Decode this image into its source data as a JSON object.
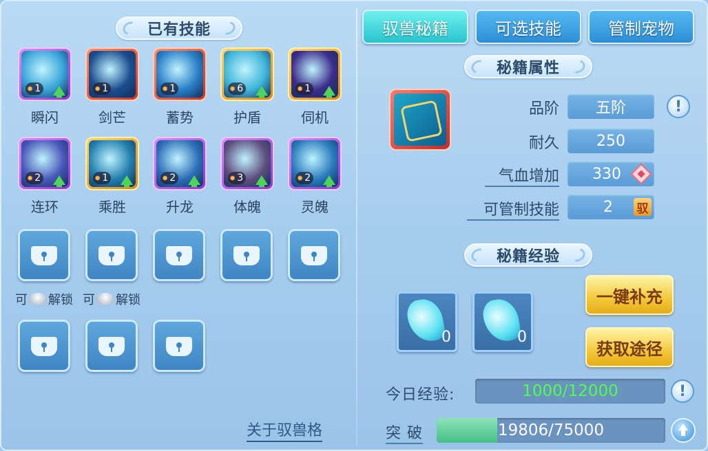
{
  "left": {
    "title": "已有技能",
    "skills": [
      {
        "name": "瞬闪",
        "level": "1",
        "upgradable": true,
        "frame": "purple",
        "color": "#3aa4d8"
      },
      {
        "name": "剑芒",
        "level": "1",
        "upgradable": false,
        "frame": "red",
        "color": "#1c4d8f"
      },
      {
        "name": "蓄势",
        "level": "1",
        "upgradable": false,
        "frame": "red",
        "color": "#2a7fc7"
      },
      {
        "name": "护盾",
        "level": "6",
        "upgradable": true,
        "frame": "gold",
        "color": "#3fb4d9"
      },
      {
        "name": "伺机",
        "level": "1",
        "upgradable": true,
        "frame": "gold",
        "color": "#3b2c8a"
      },
      {
        "name": "连环",
        "level": "2",
        "upgradable": true,
        "frame": "purple",
        "color": "#4a58b8"
      },
      {
        "name": "乘胜",
        "level": "1",
        "upgradable": true,
        "frame": "gold",
        "color": "#237fae"
      },
      {
        "name": "升龙",
        "level": "2",
        "upgradable": true,
        "frame": "purple",
        "color": "#2e6fb8"
      },
      {
        "name": "体魄",
        "level": "3",
        "upgradable": true,
        "frame": "purple",
        "color": "#5f4f7f"
      },
      {
        "name": "灵魄",
        "level": "2",
        "upgradable": true,
        "frame": "purple",
        "color": "#2a7bbd"
      }
    ],
    "unlock_label_1": "可",
    "unlock_label_2": "解锁",
    "about_link": "关于驭兽格"
  },
  "tabs": [
    {
      "label": "驭兽秘籍",
      "active": true
    },
    {
      "label": "可选技能",
      "active": false
    },
    {
      "label": "管制宠物",
      "active": false
    }
  ],
  "attributes": {
    "title": "秘籍属性",
    "rows": [
      {
        "label": "品阶",
        "value": "五阶"
      },
      {
        "label": "耐久",
        "value": "250"
      },
      {
        "label": "气血增加",
        "value": "330"
      },
      {
        "label": "可管制技能",
        "value": "2"
      }
    ],
    "tame_badge": "驭"
  },
  "experience": {
    "title": "秘籍经验",
    "items": [
      {
        "count": "0"
      },
      {
        "count": "0"
      }
    ],
    "buttons": {
      "refill": "一键补充",
      "obtain": "获取途径"
    },
    "today_label": "今日经验:",
    "today_value": "1000/12000",
    "today_fraction": 0.083,
    "break_label": "突 破",
    "break_value": "19806/75000",
    "break_fraction": 0.264
  },
  "colors": {
    "today_text": "#4dff4a",
    "break_text": "#ffffff"
  }
}
